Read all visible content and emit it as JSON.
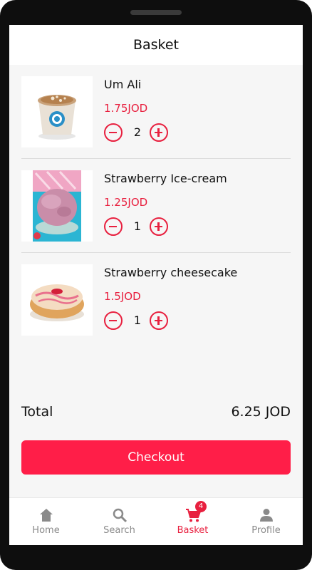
{
  "header": {
    "title": "Basket"
  },
  "items": [
    {
      "name": "Um Ali",
      "price": "1.75JOD",
      "quantity": "2",
      "image_icon": "um-ali-cup-image"
    },
    {
      "name": "Strawberry Ice-cream",
      "price": "1.25JOD",
      "quantity": "1",
      "image_icon": "strawberry-ice-cream-image"
    },
    {
      "name": "Strawberry cheesecake",
      "price": "1.5JOD",
      "quantity": "1",
      "image_icon": "strawberry-cheesecake-image"
    }
  ],
  "summary": {
    "total_label": "Total",
    "total_value": "6.25 JOD"
  },
  "checkout": {
    "label": "Checkout"
  },
  "nav": {
    "home": {
      "label": "Home",
      "icon": "home-icon"
    },
    "search": {
      "label": "Search",
      "icon": "search-icon"
    },
    "basket": {
      "label": "Basket",
      "icon": "cart-icon",
      "badge": "4"
    },
    "profile": {
      "label": "Profile",
      "icon": "person-icon"
    }
  },
  "colors": {
    "accent": "#e8203f",
    "button": "#ff1e48",
    "background": "#f6f6f6"
  }
}
